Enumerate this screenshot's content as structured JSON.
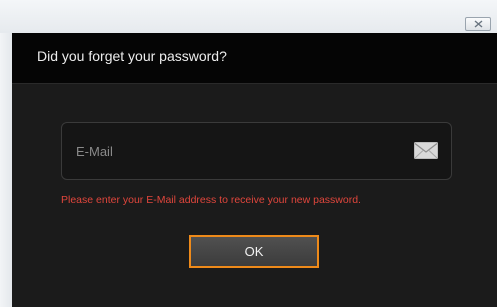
{
  "window": {
    "close_icon": "close-icon"
  },
  "dialog": {
    "title": "Did you forget your password?",
    "email": {
      "value": "",
      "placeholder": "E-Mail",
      "icon": "envelope-icon"
    },
    "hint": "Please enter your E-Mail address to receive your new password.",
    "ok_label": "OK"
  },
  "colors": {
    "background": "#1b1b1b",
    "header": "#050505",
    "hint": "#e0463c",
    "button_border": "#ee8a1a"
  }
}
